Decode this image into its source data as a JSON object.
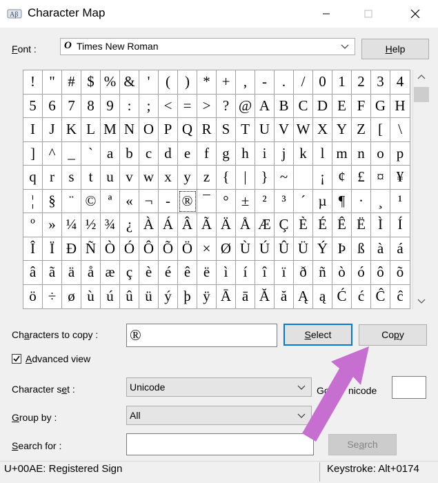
{
  "window": {
    "title": "Character Map"
  },
  "font": {
    "label": "Font :",
    "value": "Times New Roman",
    "type_glyph": "O"
  },
  "help_button": "Help",
  "grid": {
    "selected": "®",
    "rows": [
      [
        "!",
        "\"",
        "#",
        "$",
        "%",
        "&",
        "'",
        "(",
        ")",
        "*",
        "+",
        ",",
        "-",
        ".",
        "/",
        "0",
        "1",
        "2",
        "3",
        "4"
      ],
      [
        "5",
        "6",
        "7",
        "8",
        "9",
        ":",
        ";",
        "<",
        "=",
        ">",
        "?",
        "@",
        "A",
        "B",
        "C",
        "D",
        "E",
        "F",
        "G",
        "H"
      ],
      [
        "I",
        "J",
        "K",
        "L",
        "M",
        "N",
        "O",
        "P",
        "Q",
        "R",
        "S",
        "T",
        "U",
        "V",
        "W",
        "X",
        "Y",
        "Z",
        "[",
        "\\"
      ],
      [
        "]",
        "^",
        "_",
        "`",
        "a",
        "b",
        "c",
        "d",
        "e",
        "f",
        "g",
        "h",
        "i",
        "j",
        "k",
        "l",
        "m",
        "n",
        "o",
        "p"
      ],
      [
        "q",
        "r",
        "s",
        "t",
        "u",
        "v",
        "w",
        "x",
        "y",
        "z",
        "{",
        "|",
        "}",
        "~",
        " ",
        "¡",
        "¢",
        "£",
        "¤",
        "¥"
      ],
      [
        "¦",
        "§",
        "¨",
        "©",
        "ª",
        "«",
        "¬",
        "-",
        "®",
        "¯",
        "°",
        "±",
        "²",
        "³",
        "´",
        "µ",
        "¶",
        "·",
        "¸",
        "¹"
      ],
      [
        "º",
        "»",
        "¼",
        "½",
        "¾",
        "¿",
        "À",
        "Á",
        "Â",
        "Ã",
        "Ä",
        "Å",
        "Æ",
        "Ç",
        "È",
        "É",
        "Ê",
        "Ë",
        "Ì",
        "Í"
      ],
      [
        "Î",
        "Ï",
        "Ð",
        "Ñ",
        "Ò",
        "Ó",
        "Ô",
        "Õ",
        "Ö",
        "×",
        "Ø",
        "Ù",
        "Ú",
        "Û",
        "Ü",
        "Ý",
        "Þ",
        "ß",
        "à",
        "á"
      ],
      [
        "â",
        "ã",
        "ä",
        "å",
        "æ",
        "ç",
        "è",
        "é",
        "ê",
        "ë",
        "ì",
        "í",
        "î",
        "ï",
        "ð",
        "ñ",
        "ò",
        "ó",
        "ô",
        "õ"
      ],
      [
        "ö",
        "÷",
        "ø",
        "ù",
        "ú",
        "û",
        "ü",
        "ý",
        "þ",
        "ÿ",
        "Ā",
        "ā",
        "Ă",
        "ă",
        "Ą",
        "ą",
        "Ć",
        "ć",
        "Ĉ",
        "ĉ"
      ]
    ]
  },
  "copy": {
    "label": "Characters to copy :",
    "value": "®",
    "select_button": "Select",
    "copy_button": "Copy"
  },
  "advanced_view": {
    "label": "Advanced view",
    "checked": true
  },
  "character_set": {
    "label": "Character set :",
    "value": "Unicode"
  },
  "go_to_unicode": {
    "label": "Go to Unicode :",
    "visible_left": "Go",
    "visible_right": "nicode",
    "value": ""
  },
  "group_by": {
    "label": "Group by :",
    "value": "All"
  },
  "search": {
    "label": "Search for :",
    "value": "",
    "button": "Search"
  },
  "status": {
    "left": "U+00AE: Registered Sign",
    "right": "Keystroke: Alt+0174"
  },
  "colors": {
    "accent": "#0078d7",
    "arrow": "#c66fd0"
  }
}
